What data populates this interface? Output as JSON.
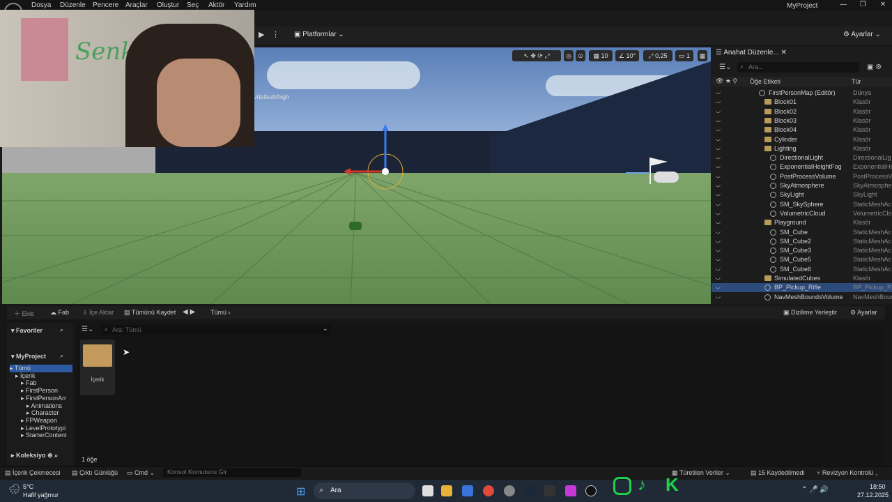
{
  "window": {
    "title": "MyProject"
  },
  "menu": [
    "Dosya",
    "Düzenle",
    "Pencere",
    "Araçlar",
    "Oluştur",
    "Seç",
    "Aktör",
    "Yardım"
  ],
  "toolbar": {
    "platforms": "Platformlar",
    "settings": "Ayarlar"
  },
  "viewport": {
    "resolution_text": "/default/high",
    "snap_grid": "10",
    "snap_angle": "10°",
    "snap_scale": "0,25",
    "camera_speed": "1"
  },
  "webcam": {
    "graffiti_text": "Senk"
  },
  "outliner": {
    "tab": "Anahat Düzenle...",
    "search_placeholder": "Ara...",
    "col_label": "Öğe Etiketi",
    "col_type": "Tür",
    "rows": [
      {
        "name": "FirstPersonMap (Editör)",
        "type": "Dünya"
      },
      {
        "name": "Block01",
        "type": "Klasör"
      },
      {
        "name": "Block02",
        "type": "Klasör"
      },
      {
        "name": "Block03",
        "type": "Klasör"
      },
      {
        "name": "Block04",
        "type": "Klasör"
      },
      {
        "name": "Cylinder",
        "type": "Klasör"
      },
      {
        "name": "Lighting",
        "type": "Klasör"
      },
      {
        "name": "DirectionalLight",
        "type": "DirectionalLig"
      },
      {
        "name": "ExponentialHeightFog",
        "type": "ExponentialHe"
      },
      {
        "name": "PostProcessVolume",
        "type": "PostProcessVo"
      },
      {
        "name": "SkyAtmosphere",
        "type": "SkyAtmosphe"
      },
      {
        "name": "SkyLight",
        "type": "SkyLight"
      },
      {
        "name": "SM_SkySphere",
        "type": "StaticMeshAc"
      },
      {
        "name": "VolumetricCloud",
        "type": "VolumetricClo"
      },
      {
        "name": "Playground",
        "type": "Klasör"
      },
      {
        "name": "SM_Cube",
        "type": "StaticMeshAc"
      },
      {
        "name": "SM_Cube2",
        "type": "StaticMeshAc"
      },
      {
        "name": "SM_Cube3",
        "type": "StaticMeshAc"
      },
      {
        "name": "SM_Cube5",
        "type": "StaticMeshAc"
      },
      {
        "name": "SM_Cube6",
        "type": "StaticMeshAc"
      },
      {
        "name": "SimulatedCubes",
        "type": "Klasör"
      },
      {
        "name": "BP_Pickup_Rifle",
        "type": "BP_Pickup_Ri"
      },
      {
        "name": "NavMeshBoundsVolume",
        "type": "NavMeshBour"
      }
    ]
  },
  "content_browser": {
    "add": "Ekle",
    "fab": "Fab",
    "import": "İçe Aktar",
    "save_all": "Tümünü Kaydet",
    "path_all": "Tümü",
    "dock": "Dizilime Yerleştir",
    "settings": "Ayarlar",
    "favorites": "Favoriler",
    "project": "MyProject",
    "search_placeholder": "Ara: Tümü",
    "folder_label": "İçerik",
    "item_count": "1 öğe",
    "collections": "Koleksiyo",
    "tree": [
      "Tümü",
      "İçerik",
      "Fab",
      "FirstPerson",
      "FirstPersonArr",
      "Animations",
      "Character",
      "FPWeapon",
      "LevelPrototypi",
      "StarterContent"
    ]
  },
  "status": {
    "content_drawer": "İçerik Çekmecesi",
    "output_log": "Çıktı Günlüğü",
    "cmd": "Cmd",
    "console_placeholder": "Konsol Komutunu Gir",
    "derived_data": "Türetilen Veriler",
    "unsaved": "15 Kaydedilmedi",
    "revision": "Revizyon Kontrolü"
  },
  "taskbar": {
    "temp": "5°C",
    "weather": "Hafif yağmur",
    "search": "Ara",
    "time": "18:50",
    "date": "27.12.2025"
  }
}
